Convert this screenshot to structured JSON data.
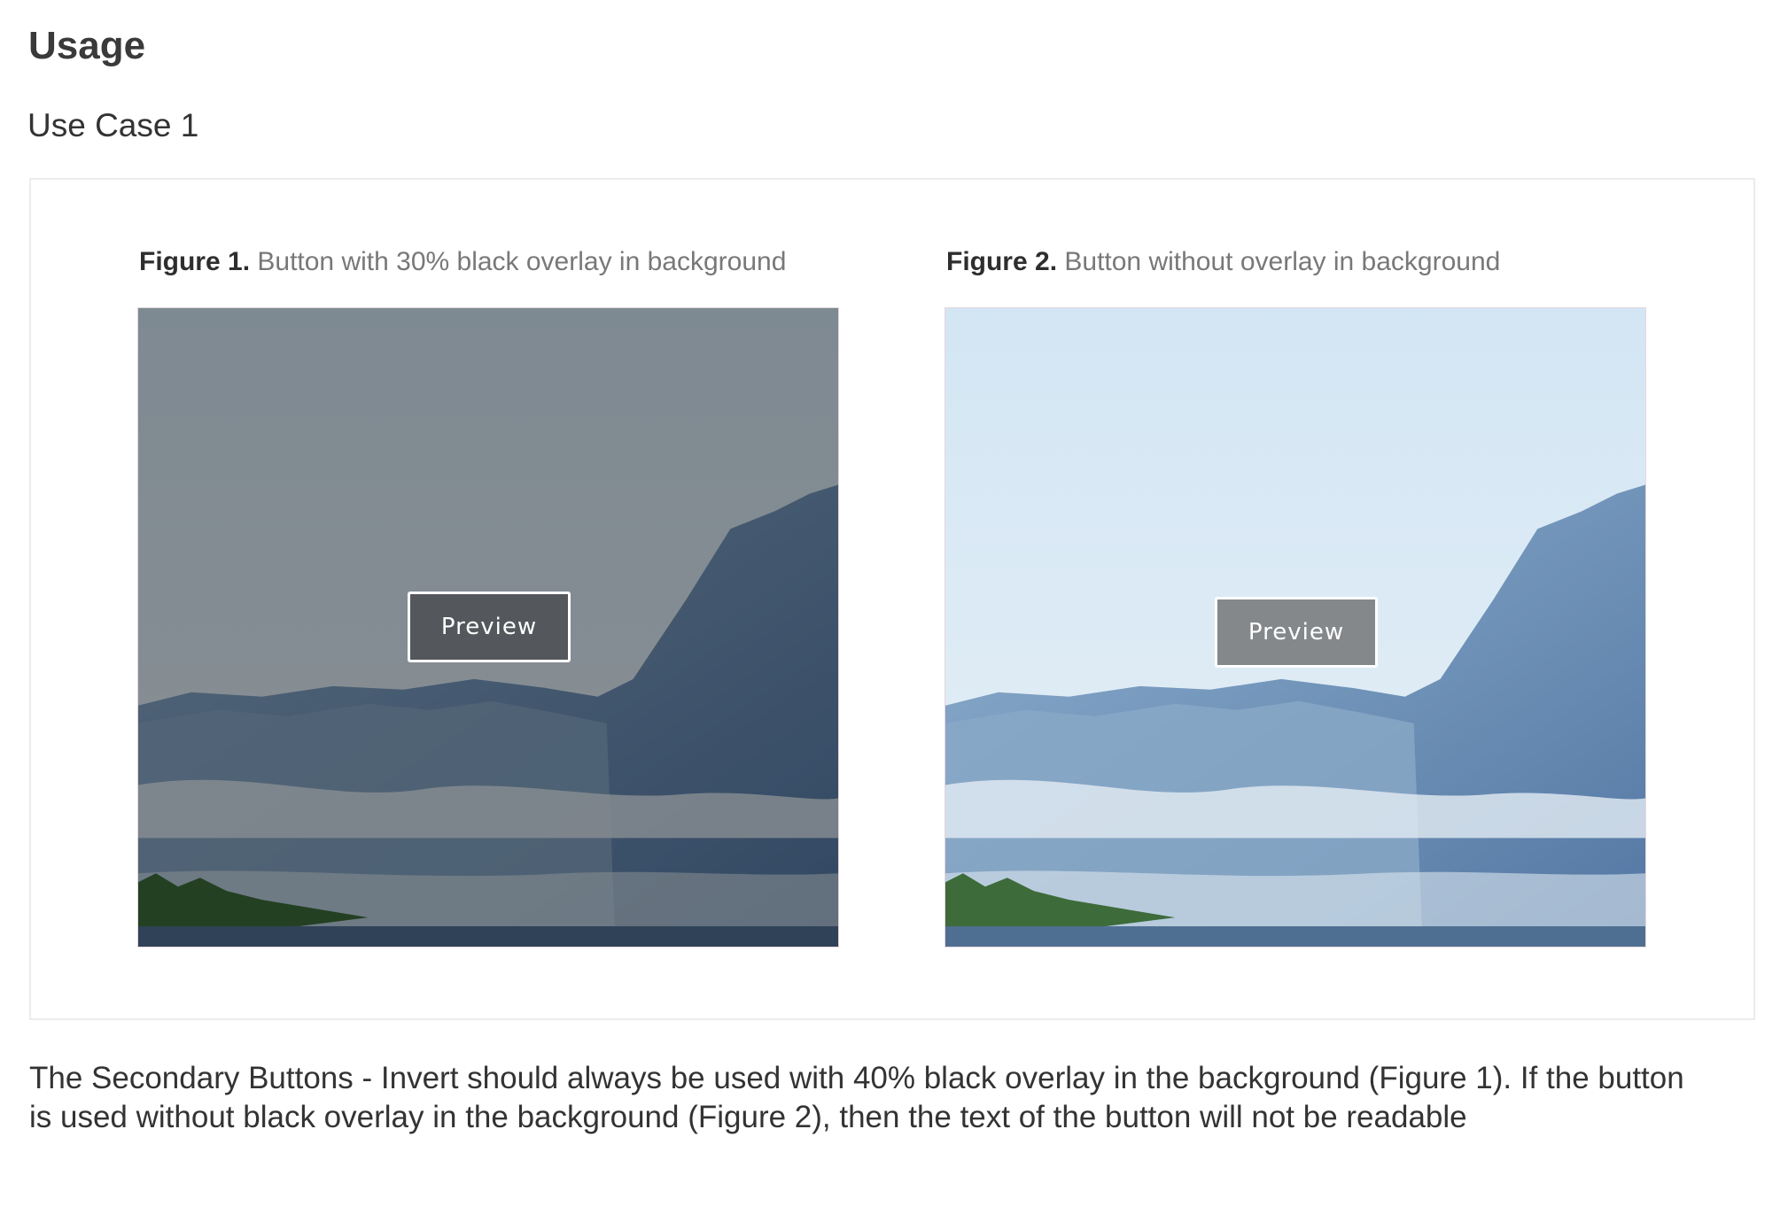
{
  "heading": "Usage",
  "subheading": "Use Case 1",
  "figures": [
    {
      "label": "Figure 1.",
      "caption": "Button with 30% black overlay in background",
      "button_label": "Preview",
      "has_overlay": true
    },
    {
      "label": "Figure 2.",
      "caption": "Button without overlay in background",
      "button_label": "Preview",
      "has_overlay": false
    }
  ],
  "description": "The Secondary Buttons - Invert should always be used with 40% black overlay in the background (Figure 1). If the button is used without black overlay in the background (Figure 2), then the text of the button will not be readable",
  "colors": {
    "sky": "#d6e8f5",
    "mountain": "#5a7fa9",
    "mist": "#dfe9f2",
    "trees": "#3d6b3a",
    "overlay_button": "#54585c",
    "plain_button": "#85888b"
  },
  "icons": {
    "figure_image": "mountain-lake-photo"
  }
}
